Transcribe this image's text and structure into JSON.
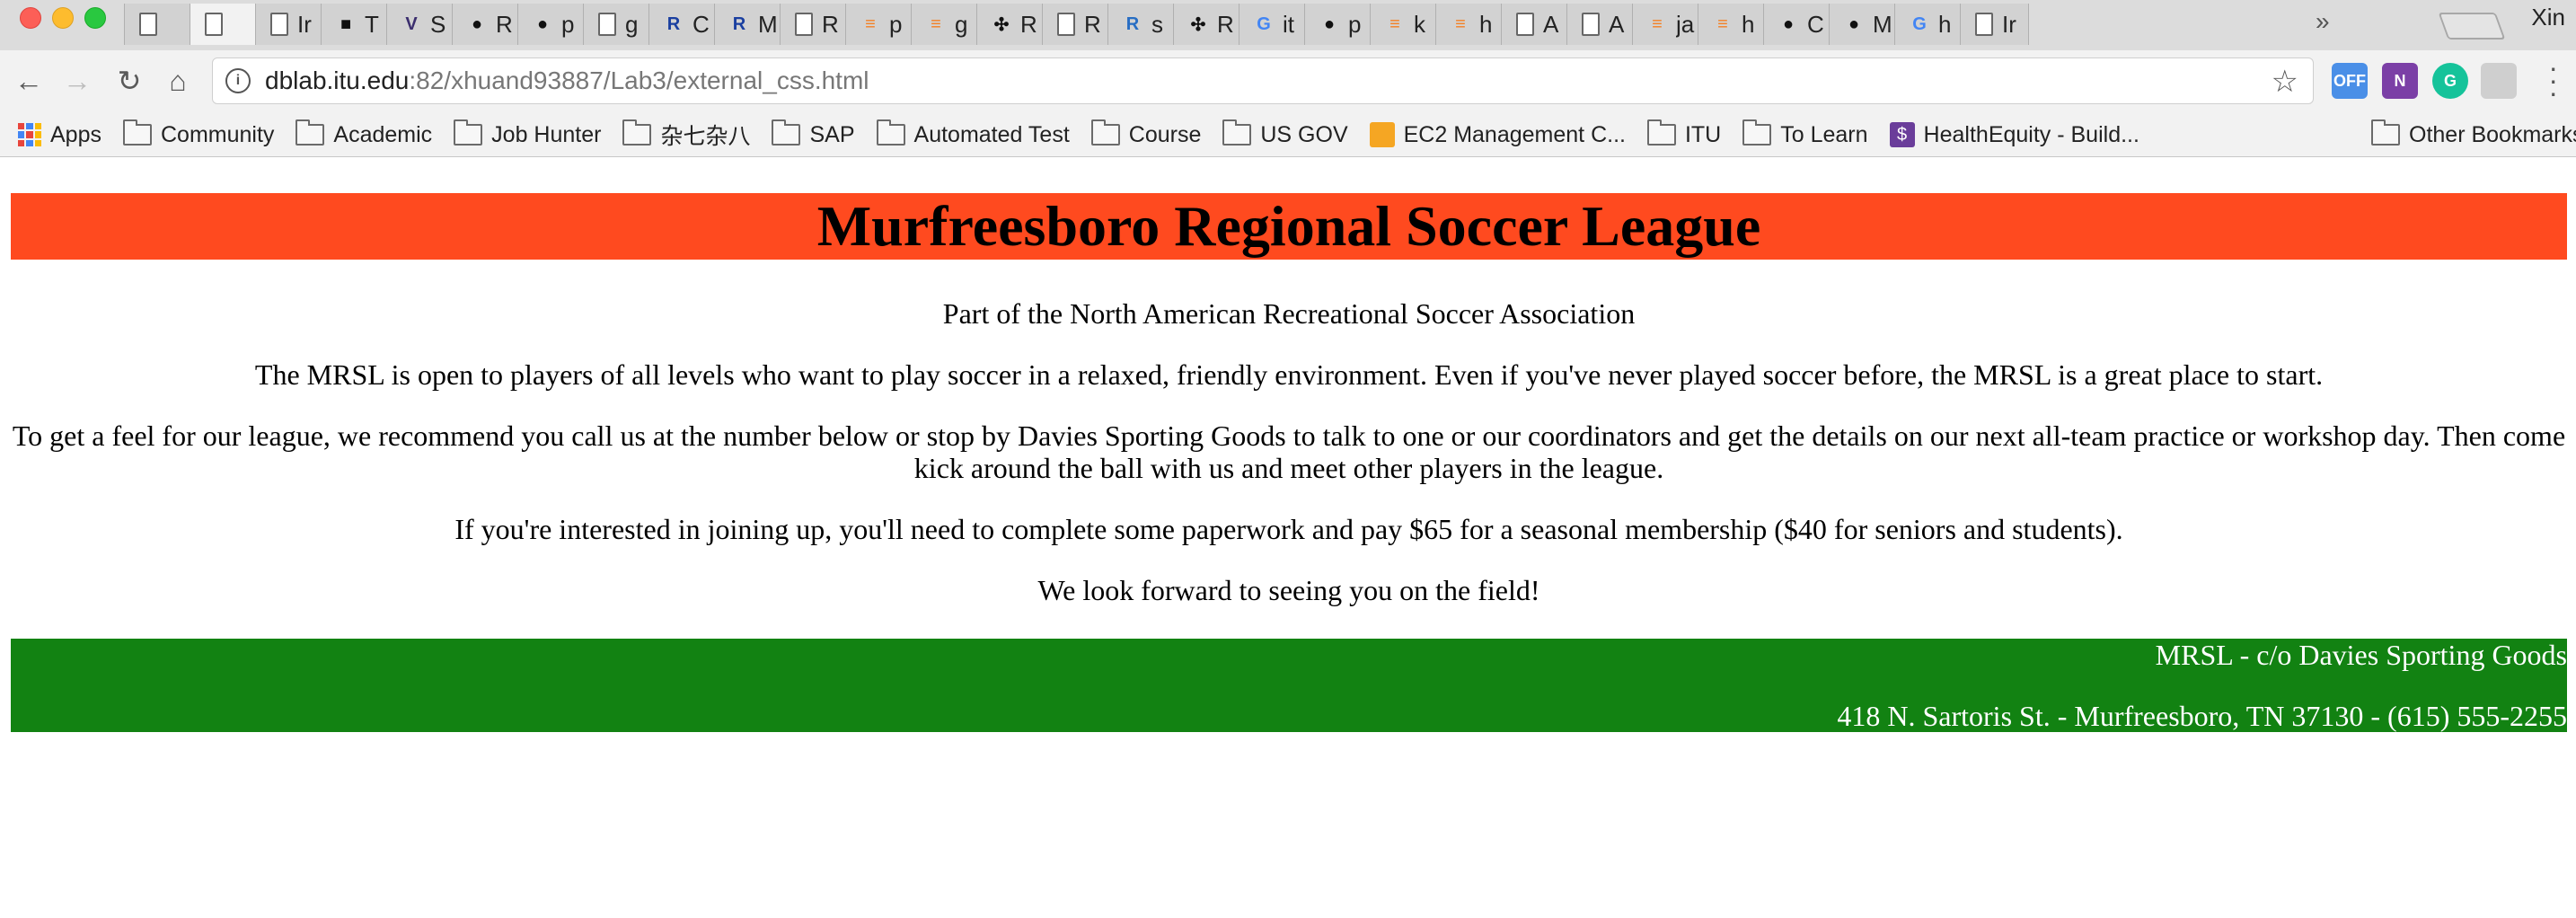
{
  "browser": {
    "tabs": [
      {
        "icon": "document-icon",
        "title": ""
      },
      {
        "icon": "document-icon",
        "title": "",
        "active": true
      },
      {
        "icon": "document-icon",
        "title": "Ir"
      },
      {
        "icon": "puzzle-icon",
        "title": "T"
      },
      {
        "icon": "vue-icon",
        "title": "S"
      },
      {
        "icon": "github-icon",
        "title": "R"
      },
      {
        "icon": "github-icon",
        "title": "p"
      },
      {
        "icon": "document-icon",
        "title": "g"
      },
      {
        "icon": "r-icon",
        "title": "C"
      },
      {
        "icon": "r-icon",
        "title": "M"
      },
      {
        "icon": "document-icon",
        "title": "R"
      },
      {
        "icon": "stackoverflow-icon",
        "title": "p"
      },
      {
        "icon": "stackoverflow-icon",
        "title": "g"
      },
      {
        "icon": "pinwheel-icon",
        "title": "R"
      },
      {
        "icon": "document-icon",
        "title": "R"
      },
      {
        "icon": "r-logo-icon",
        "title": "s"
      },
      {
        "icon": "pinwheel-icon",
        "title": "R"
      },
      {
        "icon": "google-icon",
        "title": "it"
      },
      {
        "icon": "github-icon",
        "title": "p"
      },
      {
        "icon": "stackoverflow-icon",
        "title": "k"
      },
      {
        "icon": "stackoverflow-icon",
        "title": "h"
      },
      {
        "icon": "document-icon",
        "title": "A"
      },
      {
        "icon": "document-icon",
        "title": "A"
      },
      {
        "icon": "stackoverflow-icon",
        "title": "ja"
      },
      {
        "icon": "stackoverflow-icon",
        "title": "h"
      },
      {
        "icon": "github-icon",
        "title": "C"
      },
      {
        "icon": "github-icon",
        "title": "M"
      },
      {
        "icon": "google-icon",
        "title": "h"
      },
      {
        "icon": "document-icon",
        "title": "Ir"
      }
    ],
    "profile_name": "Xin",
    "url_host": "dblab.itu.edu",
    "url_rest": ":82/xhuand93887/Lab3/external_css.html",
    "extensions": [
      "OFF",
      "N",
      "G"
    ],
    "bookmarks": [
      {
        "icon": "apps",
        "label": "Apps"
      },
      {
        "icon": "folder",
        "label": "Community"
      },
      {
        "icon": "folder",
        "label": "Academic"
      },
      {
        "icon": "folder",
        "label": "Job Hunter"
      },
      {
        "icon": "folder",
        "label": "杂七杂八"
      },
      {
        "icon": "folder",
        "label": "SAP"
      },
      {
        "icon": "folder",
        "label": "Automated Test"
      },
      {
        "icon": "folder",
        "label": "Course"
      },
      {
        "icon": "folder",
        "label": "US GOV"
      },
      {
        "icon": "box",
        "label": "EC2 Management C..."
      },
      {
        "icon": "folder",
        "label": "ITU"
      },
      {
        "icon": "folder",
        "label": "To Learn"
      },
      {
        "icon": "dollar",
        "label": "HealthEquity - Build..."
      }
    ],
    "bookmarks_more": "»",
    "other_bookmarks": "Other Bookmarks"
  },
  "page": {
    "heading": "Murfreesboro Regional Soccer League",
    "subtitle": "Part of the North American Recreational Soccer Association",
    "paragraphs": [
      "The MRSL is open to players of all levels who want to play soccer in a relaxed, friendly environment. Even if you've never played soccer before, the MRSL is a great place to start.",
      "To get a feel for our league, we recommend you call us at the number below or stop by Davies Sporting Goods to talk to one or our coordinators and get the details on our next all-team practice or workshop day. Then come kick around the ball with us and meet other players in the league.",
      "If you're interested in joining up, you'll need to complete some paperwork and pay $65 for a seasonal membership ($40 for seniors and students).",
      "We look forward to seeing you on the field!"
    ],
    "footer_line1": "MRSL - c/o Davies Sporting Goods",
    "footer_line2": "418 N. Sartoris St. - Murfreesboro, TN 37130 - (615) 555-2255"
  },
  "colors": {
    "header_band": "#ff4a1f",
    "footer_band": "#128212"
  }
}
